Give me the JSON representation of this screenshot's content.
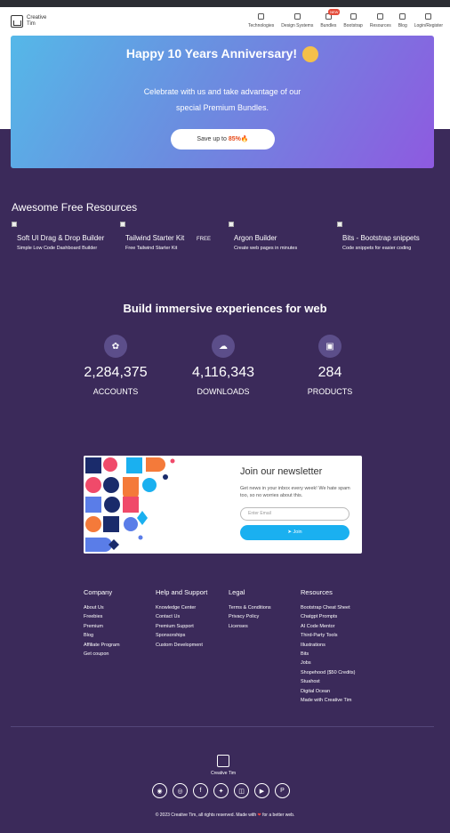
{
  "brand": {
    "line1": "Creative",
    "line2": "Tim"
  },
  "nav": [
    {
      "label": "Technologies",
      "icon": "grid-icon",
      "chevron": true
    },
    {
      "label": "Design Systems",
      "icon": "edit-icon",
      "chevron": true
    },
    {
      "label": "Bundles",
      "icon": "bundle-icon",
      "chevron": true,
      "badge": "NEW"
    },
    {
      "label": "Bootstrap",
      "icon": "bootstrap-icon",
      "chevron": true
    },
    {
      "label": "Resources",
      "icon": "box-icon",
      "chevron": true
    },
    {
      "label": "Blog",
      "icon": "doc-icon",
      "chevron": false
    },
    {
      "label": "Login/Register",
      "icon": "user-icon",
      "chevron": false
    }
  ],
  "hero": {
    "title": "Happy 10 Years Anniversary!",
    "subtitle_line1": "Celebrate with us and take advantage of our",
    "subtitle_line2": "special Premium Bundles.",
    "button_prefix": "Save up to ",
    "button_percent": "85%",
    "button_icon": "🔥"
  },
  "resources": {
    "title": "Awesome Free Resources",
    "free_badge": "FREE",
    "items": [
      {
        "title": "Soft UI Drag & Drop Builder",
        "subtitle": "Simple Low Code Dashboard Builder"
      },
      {
        "title": "Tailwind Starter Kit",
        "subtitle": "Free Tailwind Starter Kit"
      },
      {
        "title": "Argon Builder",
        "subtitle": "Create web pages in minutes"
      },
      {
        "title": "Bits - Bootstrap snippets",
        "subtitle": "Code snippets for easier coding"
      }
    ]
  },
  "stats": {
    "title": "Build immersive experiences for web",
    "items": [
      {
        "value": "2,284,375",
        "label": "ACCOUNTS",
        "icon": "paw-icon"
      },
      {
        "value": "4,116,343",
        "label": "DOWNLOADS",
        "icon": "cloud-download-icon"
      },
      {
        "value": "284",
        "label": "PRODUCTS",
        "icon": "folder-code-icon"
      }
    ]
  },
  "newsletter": {
    "title": "Join our newsletter",
    "text": "Get news in your inbox every week! We hate spam too, so no worries about this.",
    "placeholder": "Enter Email",
    "button": "Join"
  },
  "footer": {
    "columns": [
      {
        "heading": "Company",
        "links": [
          "About Us",
          "Freebies",
          "Premium",
          "Blog",
          "Affiliate Program",
          "Get coupon"
        ]
      },
      {
        "heading": "Help and Support",
        "links": [
          "Knowledge Center",
          "Contact Us",
          "Premium Support",
          "Sponsorships",
          "Custom Development"
        ]
      },
      {
        "heading": "Legal",
        "links": [
          "Terms & Conditions",
          "Privacy Policy",
          "Licenses"
        ]
      },
      {
        "heading": "Resources",
        "links": [
          "Bootstrap Cheat Sheet",
          "Chatgpt Prompts",
          "AI Code Mentor",
          "Third-Party Tools",
          "Illustrations",
          "Bits",
          "Jobs",
          "Shopehood ($50 Credits)",
          "Stuahost",
          "Digital Ocean",
          "Made with Creative Tim"
        ]
      }
    ],
    "logo_text": "Creative Tim",
    "socials": [
      "github-icon",
      "dribbble-icon",
      "facebook-icon",
      "twitter-icon",
      "instagram-icon",
      "youtube-icon",
      "pinterest-icon"
    ],
    "copyright_prefix": "© 2023 Creative Tim, all rights reserved. Made with",
    "copyright_suffix": "for a better web."
  },
  "colors": {
    "background": "#3b2a5a",
    "accent": "#1ab0f0",
    "hero_start": "#55b8e8",
    "hero_end": "#8e5ae0"
  }
}
